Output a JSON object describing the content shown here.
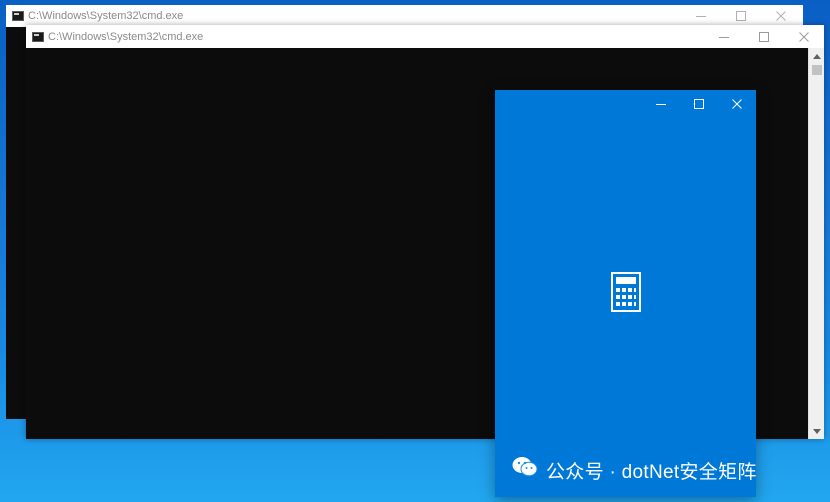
{
  "windows": {
    "cmd_back": {
      "title": "C:\\Windows\\System32\\cmd.exe"
    },
    "cmd_front": {
      "title": "C:\\Windows\\System32\\cmd.exe"
    },
    "calculator": {
      "logo": "calculator-icon"
    }
  },
  "caption_buttons": [
    "minimize-icon",
    "maximize-icon",
    "close-icon"
  ],
  "watermark": {
    "text": "公众号 · dotNet安全矩阵",
    "icon": "wechat-icon"
  },
  "colors": {
    "console_bg": "#0c0c0c",
    "calculator_bg": "#0078d7",
    "titlebar_bg": "#ffffff"
  }
}
